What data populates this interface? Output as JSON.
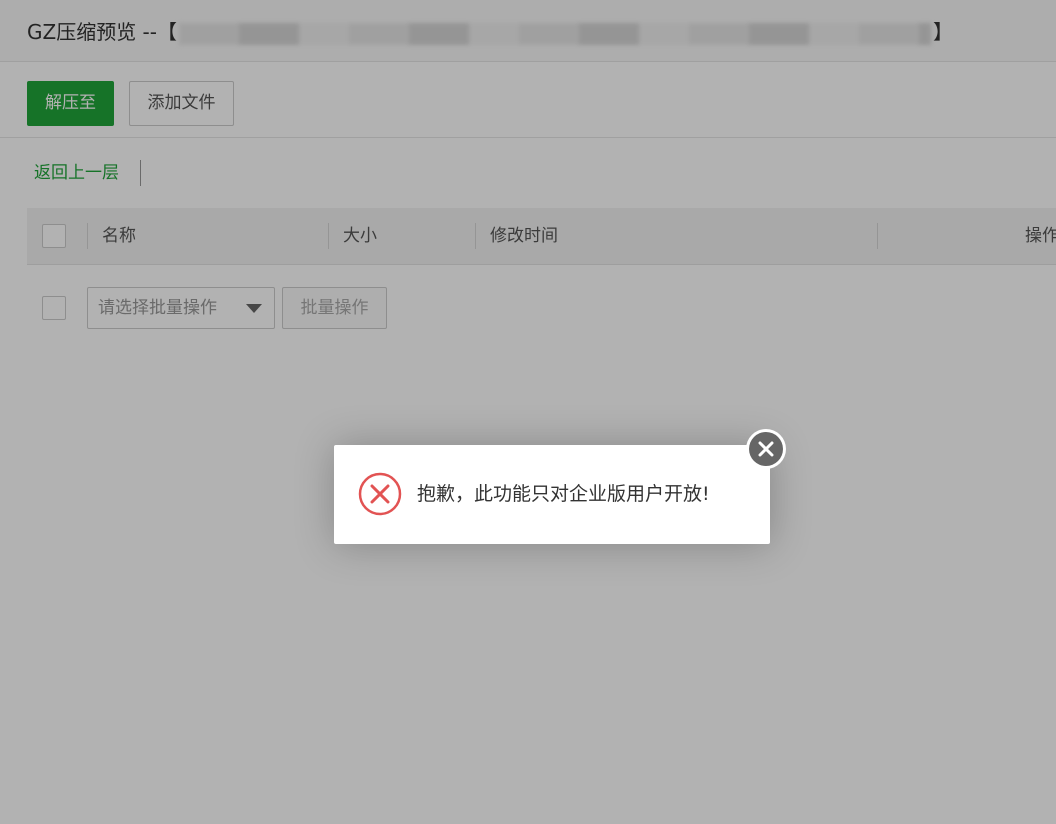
{
  "window": {
    "title_prefix": "GZ压缩预览 --【",
    "title_suffix": "】"
  },
  "toolbar": {
    "extract_label": "解压至",
    "add_file_label": "添加文件"
  },
  "nav": {
    "back_label": "返回上一层"
  },
  "table": {
    "columns": [
      "名称",
      "大小",
      "修改时间",
      "操作"
    ]
  },
  "batch": {
    "select_placeholder": "请选择批量操作",
    "batch_button_label": "批量操作"
  },
  "dialog": {
    "message": "抱歉，此功能只对企业版用户开放!"
  },
  "colors": {
    "primary": "#20a53a",
    "error": "#e25353",
    "close_button": "#666666"
  },
  "icons": {
    "dialog": "error-x-circle-icon",
    "close": "close-icon",
    "select": "caret-down-icon"
  }
}
